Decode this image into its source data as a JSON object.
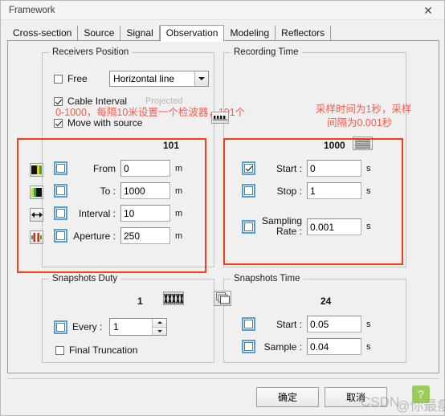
{
  "window": {
    "title": "Framework",
    "close_icon": "close-icon"
  },
  "tabs": [
    {
      "label": "Cross-section",
      "active": false
    },
    {
      "label": "Source",
      "active": false
    },
    {
      "label": "Signal",
      "active": false
    },
    {
      "label": "Observation",
      "active": true
    },
    {
      "label": "Modeling",
      "active": false
    },
    {
      "label": "Reflectors",
      "active": false
    }
  ],
  "receivers_position": {
    "legend": "Receivers Position",
    "free": {
      "label": "Free",
      "checked": false
    },
    "mode_combo": {
      "value": "Horizontal line",
      "options": [
        "Horizontal line"
      ]
    },
    "cable_interval": {
      "label": "Cable Interval",
      "checked": true
    },
    "move_with_source": {
      "label": "Move with source",
      "checked": true
    },
    "projected_label": "Projected",
    "count": "101",
    "fields": [
      {
        "icon": "receiver-from-icon",
        "label": "From",
        "value": "0",
        "unit": "m",
        "checked": false
      },
      {
        "icon": "receiver-to-icon",
        "label": "To :",
        "value": "1000",
        "unit": "m",
        "checked": false
      },
      {
        "icon": "receiver-interval-icon",
        "label": "Interval :",
        "value": "10",
        "unit": "m",
        "checked": false
      },
      {
        "icon": "receiver-aperture-icon",
        "label": "Aperture :",
        "value": "250",
        "unit": "m",
        "checked": false
      }
    ]
  },
  "recording_time": {
    "legend": "Recording Time",
    "count": "1000",
    "lines_icon": "traces-lines-icon",
    "fields": [
      {
        "label": "Start :",
        "value": "0",
        "unit": "s",
        "checked": true
      },
      {
        "label": "Stop :",
        "value": "1",
        "unit": "s",
        "checked": false
      },
      {
        "label": "Sampling\nRate :",
        "label_line1": "Sampling",
        "label_line2": "Rate :",
        "value": "0.001",
        "unit": "s",
        "checked": false
      }
    ]
  },
  "snapshots_duty": {
    "legend": "Snapshots Duty",
    "count": "1",
    "wiggle_icon": "seismic-wiggle-icon",
    "every": {
      "label": "Every :",
      "value": "1",
      "checked": false
    },
    "final_truncation": {
      "label": "Final Truncation",
      "checked": false
    }
  },
  "snapshots_time": {
    "legend": "Snapshots Time",
    "count": "24",
    "windows_icon": "stacked-windows-icon",
    "fields": [
      {
        "label": "Start :",
        "value": "0.05",
        "unit": "s",
        "checked": false
      },
      {
        "label": "Sample :",
        "value": "0.04",
        "unit": "s",
        "checked": false
      }
    ]
  },
  "buttons": {
    "ok": "确定",
    "cancel": "取消"
  },
  "annotations": {
    "receivers_note": "0-1000，每隔10米设置一个检波器，101个",
    "recording_note_line1": "采样时间为1秒，采样",
    "recording_note_line2": "间隔为0.001秒",
    "color": "#fa5a4a"
  },
  "watermark": {
    "text_left": "CSDN",
    "text_right": "@你最瘦"
  }
}
